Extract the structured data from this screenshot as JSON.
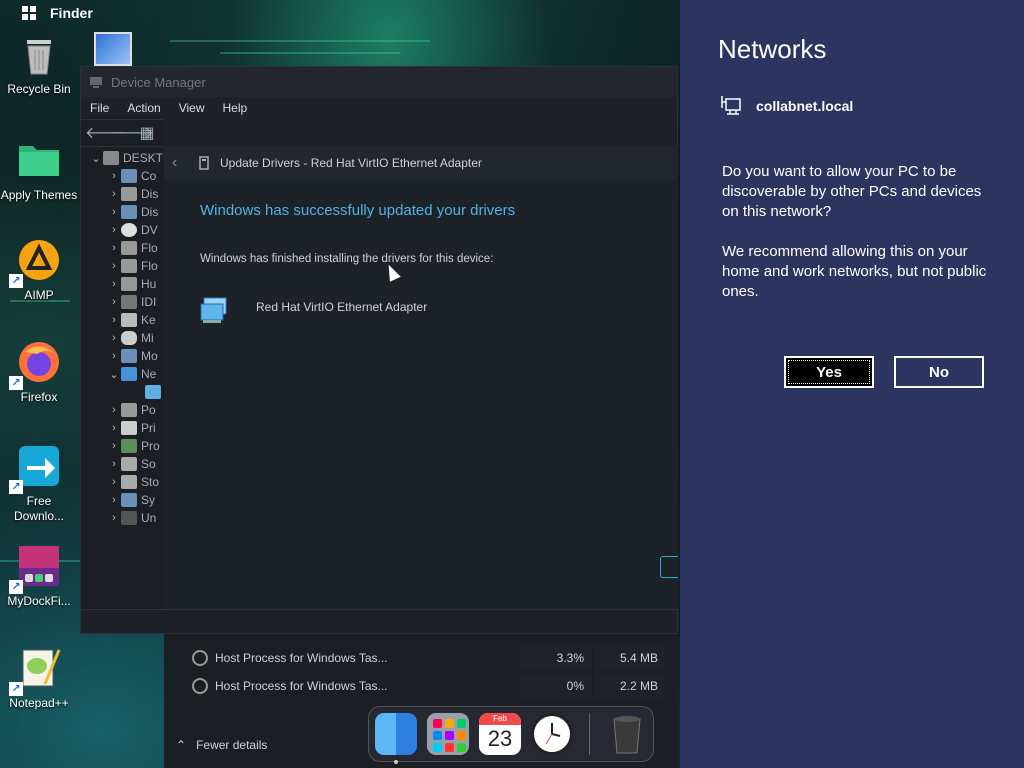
{
  "topbar": {
    "title": "Finder"
  },
  "desktop_icons": [
    {
      "name": "recycle-bin",
      "label": "Recycle Bin"
    },
    {
      "name": "apply-themes",
      "label": "Apply Themes"
    },
    {
      "name": "aimp",
      "label": "AIMP"
    },
    {
      "name": "firefox",
      "label": "Firefox"
    },
    {
      "name": "free-download",
      "label": "Free Downlo..."
    },
    {
      "name": "mydockfinder",
      "label": "MyDockFi..."
    },
    {
      "name": "notepadpp",
      "label": "Notepad++"
    }
  ],
  "device_manager": {
    "title": "Device Manager",
    "menu": [
      "File",
      "Action",
      "View",
      "Help"
    ],
    "tree": [
      {
        "label": "DESKT",
        "expanded": true,
        "root": true
      },
      {
        "label": "Co"
      },
      {
        "label": "Dis"
      },
      {
        "label": "Dis"
      },
      {
        "label": "DV"
      },
      {
        "label": "Flo"
      },
      {
        "label": "Flo"
      },
      {
        "label": "Hu"
      },
      {
        "label": "IDI"
      },
      {
        "label": "Ke"
      },
      {
        "label": "Mi"
      },
      {
        "label": "Mo"
      },
      {
        "label": "Ne",
        "expanded": true
      },
      {
        "label": "",
        "child": true
      },
      {
        "label": "Po"
      },
      {
        "label": "Pri"
      },
      {
        "label": "Pro"
      },
      {
        "label": "So"
      },
      {
        "label": "Sto"
      },
      {
        "label": "Sy"
      },
      {
        "label": "Un"
      }
    ]
  },
  "update_dialog": {
    "header": "Update Drivers - Red Hat VirtIO Ethernet Adapter",
    "heading": "Windows has successfully updated your drivers",
    "description": "Windows has finished installing the drivers for this device:",
    "device_name": "Red Hat VirtIO Ethernet Adapter"
  },
  "task_manager": {
    "rows": [
      {
        "name": "Host Process for Windows Tas...",
        "cpu": "3.3%",
        "memory": "5.4 MB"
      },
      {
        "name": "Host Process for Windows Tas...",
        "cpu": "0%",
        "memory": "2.2 MB"
      }
    ],
    "fewer_details": "Fewer details"
  },
  "dock": {
    "calendar_month": "Feb",
    "calendar_day": "23"
  },
  "networks": {
    "title": "Networks",
    "network_name": "collabnet.local",
    "question": "Do you want to allow your PC to be discoverable by other PCs and devices on this network?",
    "recommendation": "We recommend allowing this on your home and work networks, but not public ones.",
    "yes_label": "Yes",
    "no_label": "No"
  },
  "colors": {
    "networks_bg": "#2b3560",
    "accent_heading": "#4fb3e6",
    "window_bg": "#1e2127"
  }
}
